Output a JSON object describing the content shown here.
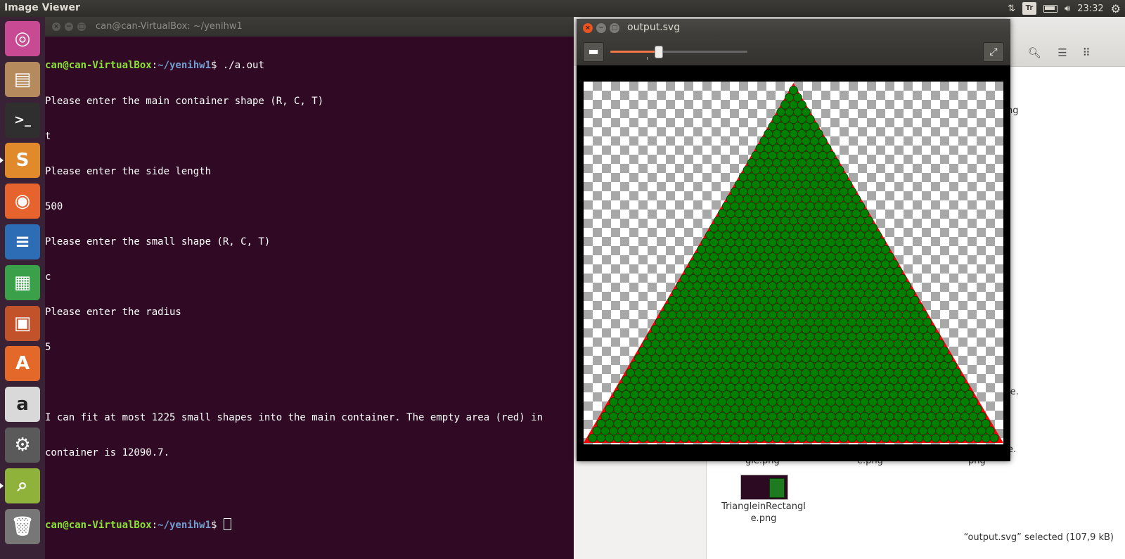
{
  "topbar": {
    "app_title": "Image Viewer",
    "keyboard_layout": "Tr",
    "clock": "23:32"
  },
  "launcher": {
    "items": [
      {
        "name": "ubuntu-dash",
        "color": "#c74a92"
      },
      {
        "name": "files",
        "color": "#b58a5c"
      },
      {
        "name": "terminal",
        "color": "#2f2f2f"
      },
      {
        "name": "sublime-text",
        "color": "#e08a2b"
      },
      {
        "name": "firefox",
        "color": "#e6632d"
      },
      {
        "name": "libreoffice-writer",
        "color": "#2d6db5"
      },
      {
        "name": "libreoffice-calc",
        "color": "#3aa14a"
      },
      {
        "name": "libreoffice-impress",
        "color": "#c2522a"
      },
      {
        "name": "ubuntu-software",
        "color": "#e4682a"
      },
      {
        "name": "amazon",
        "color": "#d9d9d9"
      },
      {
        "name": "system-settings",
        "color": "#5a5a5a"
      },
      {
        "name": "image-viewer",
        "color": "#8fb23a"
      },
      {
        "name": "trash",
        "color": "#777777"
      }
    ]
  },
  "terminal": {
    "title": "can@can-VirtualBox: ~/yenihw1",
    "prompt_user": "can@can-VirtualBox",
    "prompt_path": "~/yenihw1",
    "command": "./a.out",
    "output_lines": [
      "Please enter the main container shape (R, C, T)",
      "t",
      "Please enter the side length",
      "500",
      "Please enter the small shape (R, C, T)",
      "c",
      "Please enter the radius",
      "5",
      "",
      "I can fit at most 1225 small shapes into the main container. The empty area (red) in",
      "container is 12090.7.",
      ""
    ]
  },
  "viewer": {
    "title": "output.svg",
    "zoom_fraction": 0.35,
    "image": {
      "container_shape": "triangle",
      "container_color": "#ff0000",
      "circle_fill": "#008000",
      "circle_stroke": "#003b00",
      "rows": 49,
      "transparency_light": "#ffffff",
      "transparency_dark": "#a8a8a8"
    }
  },
  "files": {
    "fragments": [
      "ng",
      "le.",
      "e.",
      "gle.png",
      "e.png",
      "png"
    ],
    "thumbnail_name_line1": "TriangleinRectangl",
    "thumbnail_name_line2": "e.png",
    "status": "“output.svg” selected  (107,9 kB)"
  }
}
